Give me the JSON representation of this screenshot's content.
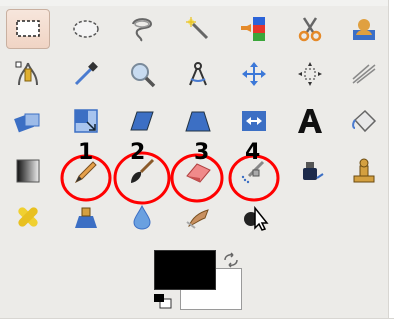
{
  "toolbox": {
    "title": "",
    "tools": [
      {
        "row": 0,
        "col": 0,
        "name": "rect-select-icon",
        "active": true
      },
      {
        "row": 0,
        "col": 1,
        "name": "ellipse-select-icon"
      },
      {
        "row": 0,
        "col": 2,
        "name": "free-select-icon"
      },
      {
        "row": 0,
        "col": 3,
        "name": "fuzzy-select-icon"
      },
      {
        "row": 0,
        "col": 4,
        "name": "select-by-color-icon"
      },
      {
        "row": 0,
        "col": 5,
        "name": "scissors-select-icon"
      },
      {
        "row": 0,
        "col": 6,
        "name": "foreground-select-icon"
      },
      {
        "row": 1,
        "col": 0,
        "name": "paths-icon"
      },
      {
        "row": 1,
        "col": 1,
        "name": "color-picker-icon"
      },
      {
        "row": 1,
        "col": 2,
        "name": "zoom-icon"
      },
      {
        "row": 1,
        "col": 3,
        "name": "measure-icon"
      },
      {
        "row": 1,
        "col": 4,
        "name": "move-icon"
      },
      {
        "row": 1,
        "col": 5,
        "name": "alignment-icon"
      },
      {
        "row": 1,
        "col": 6,
        "name": "crop-icon"
      },
      {
        "row": 2,
        "col": 0,
        "name": "rotate-icon"
      },
      {
        "row": 2,
        "col": 1,
        "name": "scale-icon"
      },
      {
        "row": 2,
        "col": 2,
        "name": "shear-icon"
      },
      {
        "row": 2,
        "col": 3,
        "name": "perspective-icon"
      },
      {
        "row": 2,
        "col": 4,
        "name": "flip-icon"
      },
      {
        "row": 2,
        "col": 5,
        "name": "text-icon"
      },
      {
        "row": 2,
        "col": 6,
        "name": "bucket-fill-icon"
      },
      {
        "row": 3,
        "col": 0,
        "name": "blend-icon"
      },
      {
        "row": 3,
        "col": 1,
        "name": "pencil-icon"
      },
      {
        "row": 3,
        "col": 2,
        "name": "paintbrush-icon"
      },
      {
        "row": 3,
        "col": 3,
        "name": "eraser-icon"
      },
      {
        "row": 3,
        "col": 4,
        "name": "airbrush-icon"
      },
      {
        "row": 3,
        "col": 5,
        "name": "ink-icon"
      },
      {
        "row": 3,
        "col": 6,
        "name": "clone-icon"
      },
      {
        "row": 4,
        "col": 0,
        "name": "heal-icon"
      },
      {
        "row": 4,
        "col": 1,
        "name": "perspective-clone-icon"
      },
      {
        "row": 4,
        "col": 2,
        "name": "blur-sharpen-icon"
      },
      {
        "row": 4,
        "col": 3,
        "name": "smudge-icon"
      },
      {
        "row": 4,
        "col": 4,
        "name": "dodge-burn-icon"
      }
    ]
  },
  "annotations": [
    {
      "label": "1",
      "target": "pencil-icon"
    },
    {
      "label": "2",
      "target": "paintbrush-icon"
    },
    {
      "label": "3",
      "target": "eraser-icon"
    },
    {
      "label": "4",
      "target": "airbrush-icon"
    }
  ],
  "colors": {
    "foreground": "#000000",
    "background": "#ffffff",
    "annotation_circle": "#ff0000",
    "active_tool_bg": "#f3dccf"
  }
}
